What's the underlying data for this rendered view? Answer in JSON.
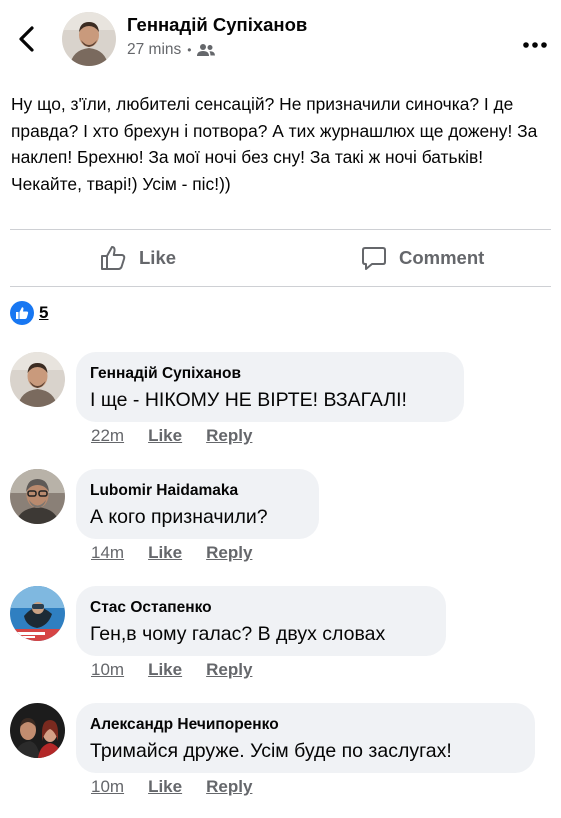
{
  "header": {
    "author": "Геннадій Супіханов",
    "time": "27 mins"
  },
  "post": {
    "text": "Ну що, з'їли, любителі сенсацій? Не призначили синочка? І де правда? І хто брехун і потвора? А тих журнашлюх ще дожену! За наклеп! Брехню! За мої ночі без сну! За такі ж ночі батьків! Чекайте, тварі!) Усім - піс!))"
  },
  "actions": {
    "like": "Like",
    "comment": "Comment"
  },
  "reactions": {
    "count": "5"
  },
  "comments": [
    {
      "author": "Геннадій Супіханов",
      "text": "І ще - НІКОМУ НЕ ВІРТЕ! ВЗАГАЛІ!",
      "time": "22m",
      "like": "Like",
      "reply": "Reply"
    },
    {
      "author": "Lubomir Haidamaka",
      "text": "А кого призначили?",
      "time": "14m",
      "like": "Like",
      "reply": "Reply"
    },
    {
      "author": "Стас Остапенко",
      "text": "Ген,в чому галас? В двух словах",
      "time": "10m",
      "like": "Like",
      "reply": "Reply"
    },
    {
      "author": "Александр Нечипоренко",
      "text": "Тримайся друже. Усім буде по заслугах!",
      "time": "10m",
      "like": "Like",
      "reply": "Reply"
    }
  ],
  "colors": {
    "accent": "#1877f2",
    "muted": "#65676b",
    "bubble": "#f0f2f5"
  }
}
